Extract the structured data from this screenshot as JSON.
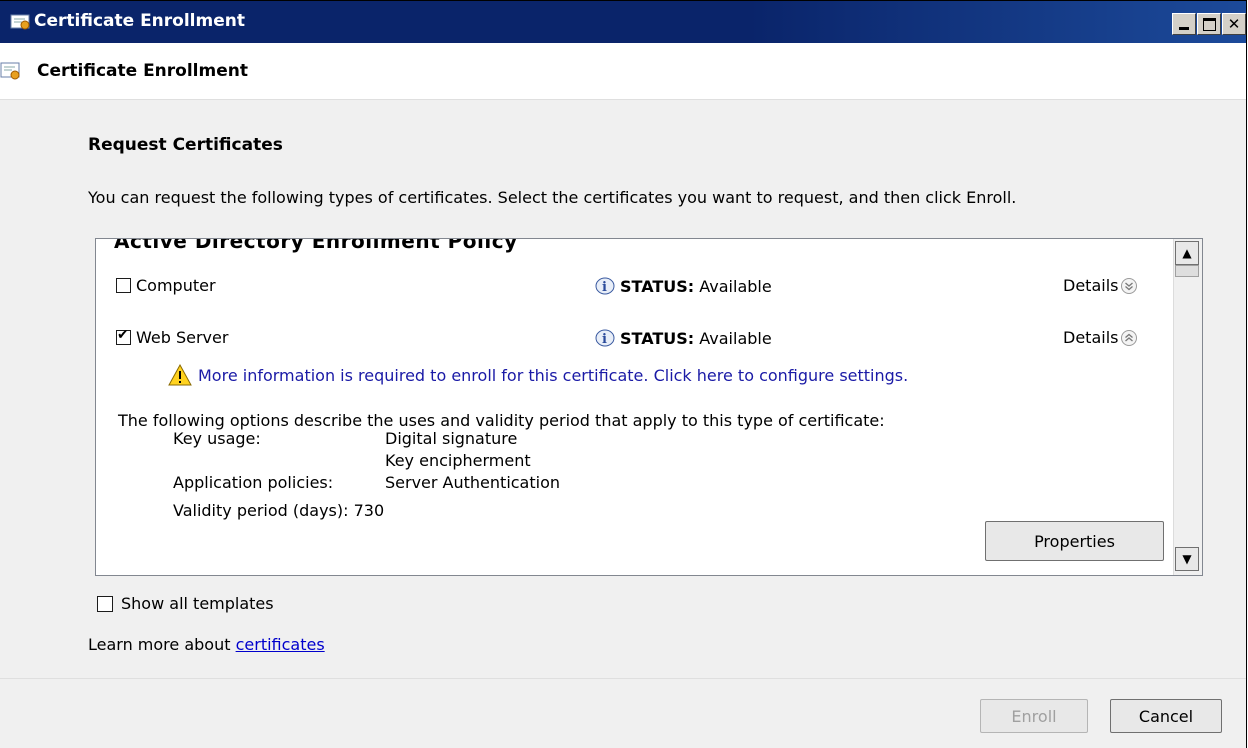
{
  "window": {
    "title": "Certificate Enrollment",
    "controls": [
      "minimize-icon",
      "maximize-icon",
      "close-icon"
    ]
  },
  "header": {
    "title": "Certificate Enrollment"
  },
  "page": {
    "title": "Request Certificates",
    "description": "You can request the following types of certificates. Select the certificates you want to request, and then click Enroll."
  },
  "list": {
    "policy_heading": "Active Directory Enrollment Policy",
    "items": [
      {
        "label": "Computer",
        "checked": false,
        "status_label": "STATUS:",
        "status_value": "Available",
        "details_label": "Details",
        "expanded": false
      },
      {
        "label": "Web Server",
        "checked": true,
        "status_label": "STATUS:",
        "status_value": "Available",
        "details_label": "Details",
        "expanded": true
      }
    ],
    "warning": "More information is required to enroll for this certificate. Click here to configure settings.",
    "options_desc": "The following options describe the uses and validity period that apply to this type of certificate:",
    "key_usage_label": "Key usage:",
    "key_usage_values": [
      "Digital signature",
      "Key encipherment"
    ],
    "app_policies_label": "Application policies:",
    "app_policies_value": "Server Authentication",
    "validity_label": "Validity period (days):",
    "validity_value": "730",
    "properties_button": "Properties"
  },
  "show_all": {
    "label": "Show all templates",
    "checked": false
  },
  "learn_more": {
    "prefix": "Learn more about ",
    "link": "certificates"
  },
  "footer": {
    "enroll_label": "Enroll",
    "enroll_enabled": false,
    "cancel_label": "Cancel"
  },
  "colors": {
    "title_bar": "#0a246a",
    "link": "#0000cc",
    "warning_text": "#1a1aa6",
    "window_bg": "#f0f0f0"
  }
}
